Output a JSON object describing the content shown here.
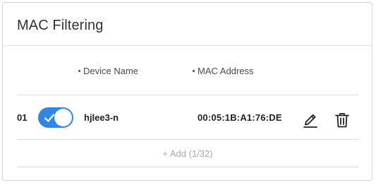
{
  "card": {
    "title": "MAC Filtering"
  },
  "columns": {
    "device_name": "Device Name",
    "mac_address": "MAC Address"
  },
  "rows": [
    {
      "index": "01",
      "enabled": true,
      "device_name": "hjlee3-n",
      "mac_address": "00:05:1B:A1:76:DE"
    }
  ],
  "add_button": {
    "label": "+ Add (1/32)"
  },
  "colors": {
    "toggle_on": "#2f86e6",
    "text_primary": "#222222",
    "text_muted": "#a8a8a8",
    "divider": "#dcdcdc"
  },
  "icons": {
    "toggle_check": "check-icon",
    "edit": "pencil-icon",
    "delete": "trash-icon"
  }
}
